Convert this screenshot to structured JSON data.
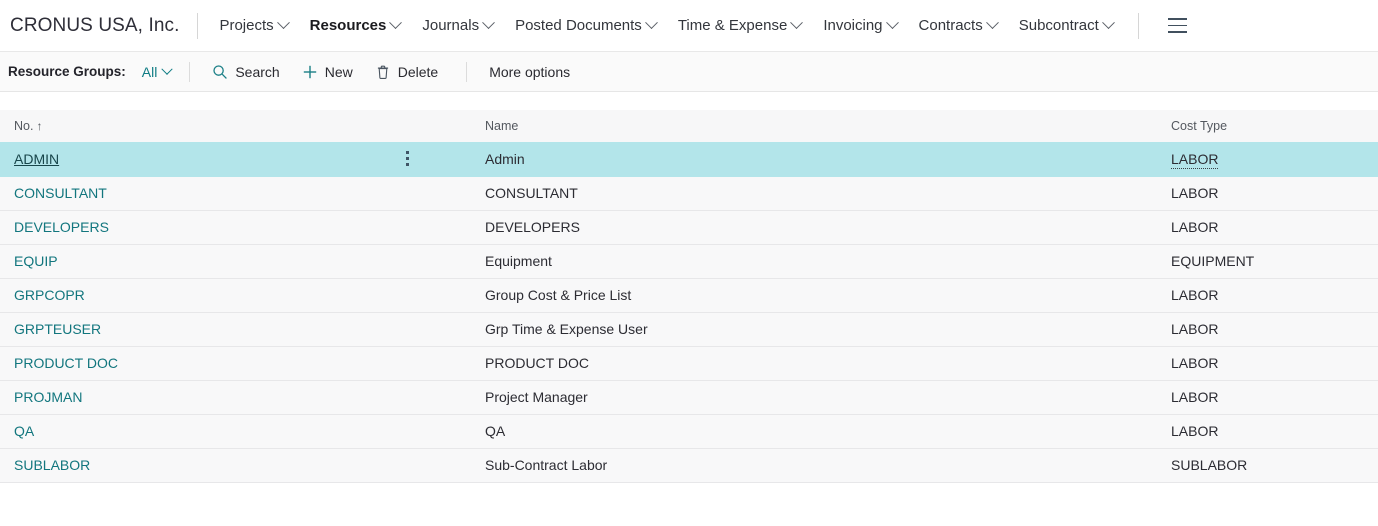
{
  "topnav": {
    "company": "CRONUS USA, Inc.",
    "items": [
      {
        "label": "Projects",
        "has_chevron": true,
        "active": false
      },
      {
        "label": "Resources",
        "has_chevron": true,
        "active": true
      },
      {
        "label": "Journals",
        "has_chevron": true,
        "active": false
      },
      {
        "label": "Posted Documents",
        "has_chevron": true,
        "active": false
      },
      {
        "label": "Time & Expense",
        "has_chevron": true,
        "active": false
      },
      {
        "label": "Invoicing",
        "has_chevron": true,
        "active": false
      },
      {
        "label": "Contracts",
        "has_chevron": true,
        "active": false
      },
      {
        "label": "Subcontract",
        "has_chevron": true,
        "active": false
      }
    ],
    "menu_icon": "hamburger-icon"
  },
  "toolbar": {
    "page_label": "Resource Groups:",
    "filter_value": "All",
    "search_label": "Search",
    "search_icon": "search-icon",
    "new_label": "New",
    "new_icon": "plus-icon",
    "delete_label": "Delete",
    "delete_icon": "trash-icon",
    "more_options_label": "More options"
  },
  "grid": {
    "columns": [
      {
        "key": "no",
        "label": "No.",
        "sort_indicator": "↑"
      },
      {
        "key": "name",
        "label": "Name",
        "sort_indicator": ""
      },
      {
        "key": "cost",
        "label": "Cost Type",
        "sort_indicator": ""
      }
    ],
    "rows": [
      {
        "no": "ADMIN",
        "name": "Admin",
        "cost": "LABOR",
        "selected": true
      },
      {
        "no": "CONSULTANT",
        "name": "CONSULTANT",
        "cost": "LABOR",
        "selected": false
      },
      {
        "no": "DEVELOPERS",
        "name": "DEVELOPERS",
        "cost": "LABOR",
        "selected": false
      },
      {
        "no": "EQUIP",
        "name": "Equipment",
        "cost": "EQUIPMENT",
        "selected": false
      },
      {
        "no": "GRPCOPR",
        "name": "Group Cost & Price List",
        "cost": "LABOR",
        "selected": false
      },
      {
        "no": "GRPTEUSER",
        "name": "Grp Time & Expense User",
        "cost": "LABOR",
        "selected": false
      },
      {
        "no": "PRODUCT DOC",
        "name": "PRODUCT DOC",
        "cost": "LABOR",
        "selected": false
      },
      {
        "no": "PROJMAN",
        "name": "Project Manager",
        "cost": "LABOR",
        "selected": false
      },
      {
        "no": "QA",
        "name": "QA",
        "cost": "LABOR",
        "selected": false
      },
      {
        "no": "SUBLABOR",
        "name": "Sub-Contract Labor",
        "cost": "SUBLABOR",
        "selected": false
      }
    ],
    "row_menu_icon": "more-vertical-icon"
  },
  "colors": {
    "accent_teal": "#12767e",
    "selected_row": "#b3e5ea",
    "row_background": "#f8f8f9",
    "header_background": "#f7f7f8"
  }
}
